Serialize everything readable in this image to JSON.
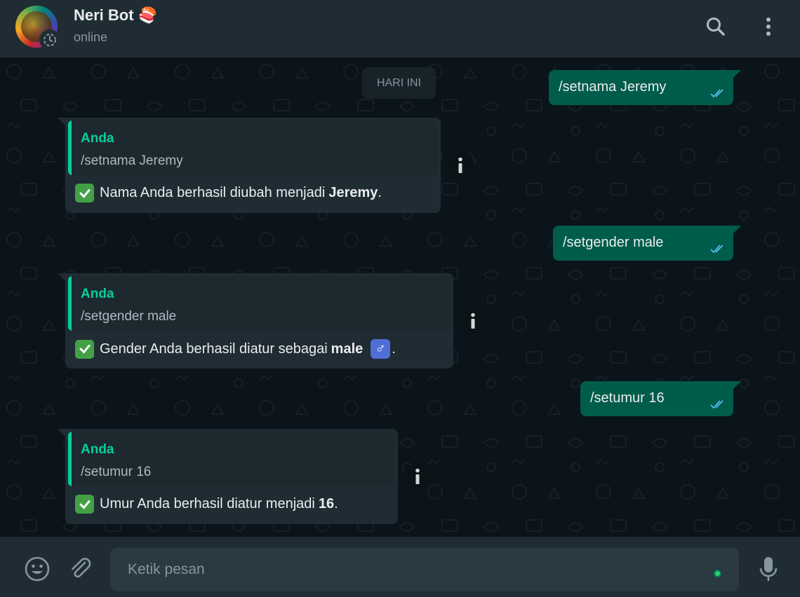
{
  "header": {
    "contact_name": "Neri Bot 🍣",
    "status": "online",
    "icons": [
      "avatar",
      "status-icon",
      "search-icon",
      "menu-icon"
    ]
  },
  "chat": {
    "date_divider": "HARI INI",
    "messages": [
      {
        "direction": "outgoing",
        "text": "/setnama Jeremy",
        "status": "read"
      },
      {
        "direction": "incoming",
        "quote_author": "Anda",
        "quote_text": "/setnama Jeremy",
        "emoji": "✅",
        "text_before": "Nama Anda berhasil diubah menjadi",
        "bold": "Jeremy",
        "text_after": "."
      },
      {
        "direction": "outgoing",
        "text": "/setgender male",
        "status": "read"
      },
      {
        "direction": "incoming",
        "quote_author": "Anda",
        "quote_text": "/setgender male",
        "emoji": "✅",
        "text_before": "Gender Anda berhasil diatur sebagai",
        "bold": "male",
        "symbol": "♂",
        "text_after": "."
      },
      {
        "direction": "outgoing",
        "text": "/setumur 16",
        "status": "read"
      },
      {
        "direction": "incoming",
        "quote_author": "Anda",
        "quote_text": "/setumur 16",
        "emoji": "✅",
        "text_before": "Umur Anda berhasil diatur menjadi",
        "bold": "16",
        "text_after": "."
      }
    ]
  },
  "composer": {
    "placeholder": "Ketik pesan",
    "icons": [
      "emoji-icon",
      "attach-icon",
      "mic-icon"
    ]
  },
  "colors": {
    "header_bg": "#202c33",
    "chat_bg": "#0b141a",
    "outgoing_bubble": "#005c4b",
    "incoming_bubble": "#202c33",
    "accent": "#06cf9c",
    "read_tick": "#53bdeb"
  }
}
